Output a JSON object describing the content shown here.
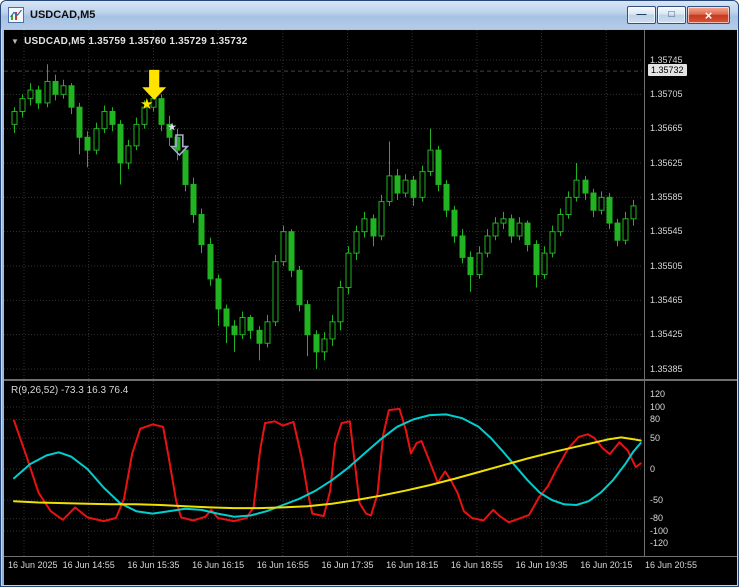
{
  "window": {
    "title": "USDCAD,M5",
    "controls": {
      "minimize": "—",
      "maximize": "□",
      "close": "×"
    }
  },
  "main_chart": {
    "header": {
      "collapse_icon": "▼",
      "text": "USDCAD,M5  1.35759 1.35760 1.35729 1.35732"
    }
  },
  "indicator_pane": {
    "header": "R(9,26,52) -73.3 16.3 76.4"
  },
  "colors": {
    "background": "#000000",
    "grid": "#323232",
    "candle": "#21b321",
    "separator": "#6f6f6f",
    "axis_text": "#d8d8d8",
    "bid_line": "#8a8a8a",
    "marker_yellow": "#ffe400",
    "marker_gray": "#aaaacf",
    "titlebar_blue": "#b4cbe8",
    "close_button_red": "#d9543a"
  },
  "chart_data": {
    "type": "candlestick",
    "symbol": "USDCAD",
    "timeframe": "M5",
    "ohlc_header_values": {
      "open": "1.35759",
      "high": "1.35760",
      "low": "1.35729",
      "close": "1.35732"
    },
    "price_axis": {
      "max": 1.35745,
      "min": 1.35385,
      "labels": [
        "1.35745",
        "1.35705",
        "1.35665",
        "1.35625",
        "1.35585",
        "1.35545",
        "1.35505",
        "1.35465",
        "1.35425",
        "1.35385"
      ],
      "current": 1.35732,
      "current_label": "1.35732"
    },
    "time_labels": [
      "16 Jun 2025",
      "16 Jun 14:55",
      "16 Jun 15:35",
      "16 Jun 16:15",
      "16 Jun 16:55",
      "16 Jun 17:35",
      "16 Jun 18:15",
      "16 Jun 18:55",
      "16 Jun 19:35",
      "16 Jun 20:15",
      "16 Jun 20:55"
    ],
    "candles": [
      [
        1.3567,
        1.3569,
        1.3566,
        1.35685
      ],
      [
        1.35685,
        1.35705,
        1.35678,
        1.357
      ],
      [
        1.357,
        1.35718,
        1.35692,
        1.3571
      ],
      [
        1.3571,
        1.35715,
        1.35688,
        1.35695
      ],
      [
        1.35695,
        1.3574,
        1.3569,
        1.3572
      ],
      [
        1.3572,
        1.35728,
        1.35698,
        1.35705
      ],
      [
        1.35705,
        1.35722,
        1.357,
        1.35715
      ],
      [
        1.35715,
        1.35718,
        1.35682,
        1.3569
      ],
      [
        1.3569,
        1.35695,
        1.35635,
        1.35655
      ],
      [
        1.35655,
        1.35662,
        1.3562,
        1.3564
      ],
      [
        1.3564,
        1.35672,
        1.35635,
        1.35665
      ],
      [
        1.35665,
        1.35692,
        1.3566,
        1.35685
      ],
      [
        1.35685,
        1.3569,
        1.35662,
        1.3567
      ],
      [
        1.3567,
        1.35675,
        1.356,
        1.35625
      ],
      [
        1.35625,
        1.35652,
        1.35618,
        1.35645
      ],
      [
        1.35645,
        1.35678,
        1.3564,
        1.3567
      ],
      [
        1.3567,
        1.35698,
        1.35665,
        1.3569
      ],
      [
        1.3569,
        1.35715,
        1.35685,
        1.357
      ],
      [
        1.357,
        1.35705,
        1.35662,
        1.3567
      ],
      [
        1.3567,
        1.3568,
        1.35645,
        1.35655
      ],
      [
        1.35655,
        1.35665,
        1.35628,
        1.3564
      ],
      [
        1.3564,
        1.35645,
        1.35592,
        1.356
      ],
      [
        1.356,
        1.35608,
        1.35555,
        1.35565
      ],
      [
        1.35565,
        1.35572,
        1.3552,
        1.3553
      ],
      [
        1.3553,
        1.35538,
        1.35482,
        1.3549
      ],
      [
        1.3549,
        1.35495,
        1.35435,
        1.35455
      ],
      [
        1.35455,
        1.3546,
        1.35415,
        1.35435
      ],
      [
        1.35435,
        1.35442,
        1.35405,
        1.35425
      ],
      [
        1.35425,
        1.35452,
        1.3542,
        1.35445
      ],
      [
        1.35445,
        1.35448,
        1.3542,
        1.3543
      ],
      [
        1.3543,
        1.35435,
        1.35395,
        1.35415
      ],
      [
        1.35415,
        1.35448,
        1.3541,
        1.3544
      ],
      [
        1.3544,
        1.35518,
        1.35435,
        1.3551
      ],
      [
        1.3551,
        1.35552,
        1.35505,
        1.35545
      ],
      [
        1.35545,
        1.35548,
        1.35492,
        1.355
      ],
      [
        1.355,
        1.35505,
        1.35452,
        1.3546
      ],
      [
        1.3546,
        1.35465,
        1.354,
        1.35425
      ],
      [
        1.35425,
        1.3543,
        1.35385,
        1.35405
      ],
      [
        1.35405,
        1.35428,
        1.35395,
        1.3542
      ],
      [
        1.3542,
        1.35448,
        1.35412,
        1.3544
      ],
      [
        1.3544,
        1.35488,
        1.3543,
        1.3548
      ],
      [
        1.3548,
        1.35528,
        1.35472,
        1.3552
      ],
      [
        1.3552,
        1.35552,
        1.35512,
        1.35545
      ],
      [
        1.35545,
        1.35568,
        1.35538,
        1.3556
      ],
      [
        1.3556,
        1.35565,
        1.35528,
        1.3554
      ],
      [
        1.3554,
        1.35588,
        1.35535,
        1.3558
      ],
      [
        1.3558,
        1.3565,
        1.35575,
        1.3561
      ],
      [
        1.3561,
        1.35618,
        1.35582,
        1.3559
      ],
      [
        1.3559,
        1.35612,
        1.35585,
        1.35605
      ],
      [
        1.35605,
        1.3561,
        1.35575,
        1.35585
      ],
      [
        1.35585,
        1.35622,
        1.3558,
        1.35615
      ],
      [
        1.35615,
        1.35665,
        1.3561,
        1.3564
      ],
      [
        1.3564,
        1.35645,
        1.35592,
        1.356
      ],
      [
        1.356,
        1.35605,
        1.35562,
        1.3557
      ],
      [
        1.3557,
        1.35575,
        1.35532,
        1.3554
      ],
      [
        1.3554,
        1.35548,
        1.35508,
        1.35515
      ],
      [
        1.35515,
        1.35522,
        1.35475,
        1.35495
      ],
      [
        1.35495,
        1.35528,
        1.3549,
        1.3552
      ],
      [
        1.3552,
        1.35548,
        1.35515,
        1.3554
      ],
      [
        1.3554,
        1.35562,
        1.35535,
        1.35555
      ],
      [
        1.35555,
        1.35568,
        1.35548,
        1.3556
      ],
      [
        1.3556,
        1.35565,
        1.35532,
        1.3554
      ],
      [
        1.3554,
        1.35562,
        1.35535,
        1.35555
      ],
      [
        1.35555,
        1.35558,
        1.35522,
        1.3553
      ],
      [
        1.3553,
        1.35535,
        1.3548,
        1.35495
      ],
      [
        1.35495,
        1.35528,
        1.3549,
        1.3552
      ],
      [
        1.3552,
        1.35552,
        1.35515,
        1.35545
      ],
      [
        1.35545,
        1.35572,
        1.3554,
        1.35565
      ],
      [
        1.35565,
        1.35592,
        1.3556,
        1.35585
      ],
      [
        1.35585,
        1.35625,
        1.3558,
        1.35605
      ],
      [
        1.35605,
        1.3561,
        1.35582,
        1.3559
      ],
      [
        1.3559,
        1.35595,
        1.35562,
        1.3557
      ],
      [
        1.3557,
        1.35592,
        1.35565,
        1.35585
      ],
      [
        1.35585,
        1.3559,
        1.35548,
        1.35555
      ],
      [
        1.35555,
        1.3556,
        1.35528,
        1.35535
      ],
      [
        1.35535,
        1.35568,
        1.3553,
        1.3556
      ],
      [
        1.3556,
        1.35582,
        1.35552,
        1.35575
      ]
    ],
    "markers": [
      {
        "name": "signal-arrow-down-yellow",
        "type": "arrow",
        "i": 17.2,
        "price": 1.35716,
        "size": 30,
        "color": "#ffe400"
      },
      {
        "name": "signal-star-yellow",
        "type": "star",
        "i": 16.3,
        "price": 1.35694,
        "size": 15,
        "color": "#ffe400"
      },
      {
        "name": "signal-star-gray",
        "type": "star",
        "i": 19.4,
        "price": 1.35667,
        "size": 11,
        "color": "#d9d9e8"
      },
      {
        "name": "signal-arrow-down-gray",
        "type": "arrow_hollow",
        "i": 20.3,
        "price": 1.35646,
        "size": 20,
        "color": "#aaaacf"
      }
    ],
    "oscillator": {
      "name": "R(9,26,52)",
      "current_values": [
        "-73.3",
        "16.3",
        "76.4"
      ],
      "range": [
        -120,
        120
      ],
      "axis_labels": [
        "120",
        "100",
        "80",
        "50",
        "0",
        "-50",
        "-80",
        "-100",
        "-120"
      ],
      "gridlines": [
        100,
        80,
        50,
        0,
        -50,
        -80,
        -100
      ],
      "series": [
        {
          "name": "red-line",
          "color": "#e81212",
          "width": 2,
          "points": [
            [
              0,
              78
            ],
            [
              1.5,
              22
            ],
            [
              3,
              -38
            ],
            [
              4.5,
              -68
            ],
            [
              6,
              -82
            ],
            [
              7.5,
              -62
            ],
            [
              9,
              -78
            ],
            [
              11,
              -84
            ],
            [
              12.5,
              -79
            ],
            [
              13.5,
              -48
            ],
            [
              14.5,
              25
            ],
            [
              15.5,
              65
            ],
            [
              17,
              72
            ],
            [
              18.3,
              68
            ],
            [
              19,
              18
            ],
            [
              19.9,
              -52
            ],
            [
              20.5,
              -78
            ],
            [
              22,
              -83
            ],
            [
              23.5,
              -77
            ],
            [
              24.2,
              -66
            ],
            [
              25,
              -79
            ],
            [
              27,
              -84
            ],
            [
              28.5,
              -79
            ],
            [
              29.4,
              -62
            ],
            [
              30.2,
              30
            ],
            [
              30.8,
              74
            ],
            [
              32,
              77
            ],
            [
              33,
              70
            ],
            [
              34.3,
              76
            ],
            [
              35.3,
              18
            ],
            [
              36,
              -35
            ],
            [
              36.6,
              -72
            ],
            [
              38,
              -76
            ],
            [
              38.8,
              -35
            ],
            [
              39.4,
              42
            ],
            [
              40.2,
              74
            ],
            [
              41.2,
              77
            ],
            [
              42.4,
              -55
            ],
            [
              43.2,
              -72
            ],
            [
              43.8,
              -75
            ],
            [
              44.6,
              -40
            ],
            [
              45.3,
              55
            ],
            [
              46,
              95
            ],
            [
              47.3,
              97
            ],
            [
              48.1,
              62
            ],
            [
              48.7,
              25
            ],
            [
              49.4,
              42
            ],
            [
              50,
              45
            ],
            [
              51,
              12
            ],
            [
              52,
              -22
            ],
            [
              52.9,
              -4
            ],
            [
              53.6,
              -18
            ],
            [
              54.4,
              -38
            ],
            [
              55.2,
              -68
            ],
            [
              56.2,
              -79
            ],
            [
              57.6,
              -83
            ],
            [
              58.8,
              -66
            ],
            [
              59.6,
              -76
            ],
            [
              60.7,
              -86
            ],
            [
              62,
              -80
            ],
            [
              63.2,
              -74
            ],
            [
              64.4,
              -46
            ],
            [
              65.5,
              -28
            ],
            [
              66.5,
              -2
            ],
            [
              68,
              33
            ],
            [
              69.3,
              52
            ],
            [
              70.4,
              56
            ],
            [
              71.2,
              50
            ],
            [
              72.2,
              34
            ],
            [
              73.1,
              24
            ],
            [
              74.3,
              43
            ],
            [
              75.3,
              30
            ],
            [
              76.3,
              3
            ],
            [
              76.9,
              9
            ]
          ]
        },
        {
          "name": "cyan-line",
          "color": "#00cfcf",
          "width": 2,
          "points": [
            [
              0,
              -15
            ],
            [
              2,
              8
            ],
            [
              4,
              22
            ],
            [
              5.5,
              27
            ],
            [
              7,
              20
            ],
            [
              9,
              0
            ],
            [
              11,
              -30
            ],
            [
              13,
              -55
            ],
            [
              15,
              -68
            ],
            [
              17,
              -72
            ],
            [
              19,
              -68
            ],
            [
              21,
              -64
            ],
            [
              23,
              -66
            ],
            [
              25,
              -72
            ],
            [
              27,
              -77
            ],
            [
              29,
              -75
            ],
            [
              31,
              -68
            ],
            [
              33,
              -58
            ],
            [
              35,
              -48
            ],
            [
              37,
              -35
            ],
            [
              39,
              -18
            ],
            [
              41,
              2
            ],
            [
              43,
              25
            ],
            [
              45,
              48
            ],
            [
              47,
              68
            ],
            [
              49,
              80
            ],
            [
              51,
              87
            ],
            [
              53,
              88
            ],
            [
              55,
              82
            ],
            [
              57,
              68
            ],
            [
              58.5,
              50
            ],
            [
              60,
              28
            ],
            [
              61.5,
              5
            ],
            [
              63,
              -18
            ],
            [
              64.5,
              -38
            ],
            [
              66,
              -50
            ],
            [
              67.5,
              -57
            ],
            [
              69,
              -58
            ],
            [
              70.5,
              -52
            ],
            [
              72,
              -38
            ],
            [
              73.5,
              -18
            ],
            [
              75,
              8
            ],
            [
              76,
              28
            ],
            [
              76.9,
              42
            ]
          ]
        },
        {
          "name": "yellow-line",
          "color": "#f0e000",
          "width": 2,
          "points": [
            [
              0,
              -52
            ],
            [
              3,
              -54
            ],
            [
              6,
              -55
            ],
            [
              9,
              -56
            ],
            [
              12,
              -57
            ],
            [
              15,
              -57
            ],
            [
              18,
              -58
            ],
            [
              21,
              -60
            ],
            [
              24,
              -62
            ],
            [
              27,
              -63
            ],
            [
              30,
              -63
            ],
            [
              33,
              -62
            ],
            [
              36,
              -60
            ],
            [
              39,
              -56
            ],
            [
              42,
              -50
            ],
            [
              45,
              -43
            ],
            [
              48,
              -35
            ],
            [
              51,
              -26
            ],
            [
              54,
              -16
            ],
            [
              57,
              -5
            ],
            [
              60,
              6
            ],
            [
              63,
              17
            ],
            [
              66,
              27
            ],
            [
              69,
              36
            ],
            [
              71,
              42
            ],
            [
              73,
              48
            ],
            [
              74.5,
              51
            ],
            [
              76,
              48
            ],
            [
              76.9,
              46
            ]
          ]
        }
      ]
    }
  }
}
